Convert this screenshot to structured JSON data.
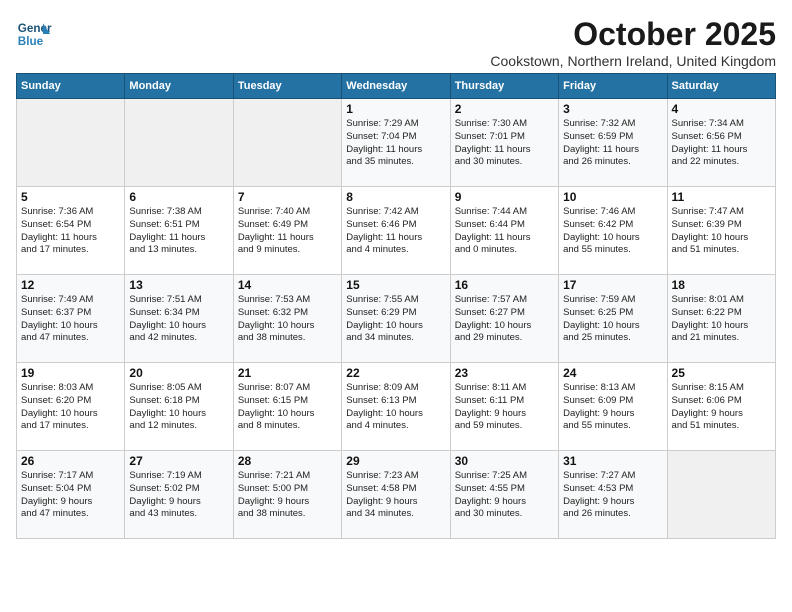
{
  "logo": {
    "line1": "General",
    "line2": "Blue"
  },
  "title": "October 2025",
  "subtitle": "Cookstown, Northern Ireland, United Kingdom",
  "weekdays": [
    "Sunday",
    "Monday",
    "Tuesday",
    "Wednesday",
    "Thursday",
    "Friday",
    "Saturday"
  ],
  "weeks": [
    [
      {
        "day": "",
        "info": ""
      },
      {
        "day": "",
        "info": ""
      },
      {
        "day": "",
        "info": ""
      },
      {
        "day": "1",
        "info": "Sunrise: 7:29 AM\nSunset: 7:04 PM\nDaylight: 11 hours\nand 35 minutes."
      },
      {
        "day": "2",
        "info": "Sunrise: 7:30 AM\nSunset: 7:01 PM\nDaylight: 11 hours\nand 30 minutes."
      },
      {
        "day": "3",
        "info": "Sunrise: 7:32 AM\nSunset: 6:59 PM\nDaylight: 11 hours\nand 26 minutes."
      },
      {
        "day": "4",
        "info": "Sunrise: 7:34 AM\nSunset: 6:56 PM\nDaylight: 11 hours\nand 22 minutes."
      }
    ],
    [
      {
        "day": "5",
        "info": "Sunrise: 7:36 AM\nSunset: 6:54 PM\nDaylight: 11 hours\nand 17 minutes."
      },
      {
        "day": "6",
        "info": "Sunrise: 7:38 AM\nSunset: 6:51 PM\nDaylight: 11 hours\nand 13 minutes."
      },
      {
        "day": "7",
        "info": "Sunrise: 7:40 AM\nSunset: 6:49 PM\nDaylight: 11 hours\nand 9 minutes."
      },
      {
        "day": "8",
        "info": "Sunrise: 7:42 AM\nSunset: 6:46 PM\nDaylight: 11 hours\nand 4 minutes."
      },
      {
        "day": "9",
        "info": "Sunrise: 7:44 AM\nSunset: 6:44 PM\nDaylight: 11 hours\nand 0 minutes."
      },
      {
        "day": "10",
        "info": "Sunrise: 7:46 AM\nSunset: 6:42 PM\nDaylight: 10 hours\nand 55 minutes."
      },
      {
        "day": "11",
        "info": "Sunrise: 7:47 AM\nSunset: 6:39 PM\nDaylight: 10 hours\nand 51 minutes."
      }
    ],
    [
      {
        "day": "12",
        "info": "Sunrise: 7:49 AM\nSunset: 6:37 PM\nDaylight: 10 hours\nand 47 minutes."
      },
      {
        "day": "13",
        "info": "Sunrise: 7:51 AM\nSunset: 6:34 PM\nDaylight: 10 hours\nand 42 minutes."
      },
      {
        "day": "14",
        "info": "Sunrise: 7:53 AM\nSunset: 6:32 PM\nDaylight: 10 hours\nand 38 minutes."
      },
      {
        "day": "15",
        "info": "Sunrise: 7:55 AM\nSunset: 6:29 PM\nDaylight: 10 hours\nand 34 minutes."
      },
      {
        "day": "16",
        "info": "Sunrise: 7:57 AM\nSunset: 6:27 PM\nDaylight: 10 hours\nand 29 minutes."
      },
      {
        "day": "17",
        "info": "Sunrise: 7:59 AM\nSunset: 6:25 PM\nDaylight: 10 hours\nand 25 minutes."
      },
      {
        "day": "18",
        "info": "Sunrise: 8:01 AM\nSunset: 6:22 PM\nDaylight: 10 hours\nand 21 minutes."
      }
    ],
    [
      {
        "day": "19",
        "info": "Sunrise: 8:03 AM\nSunset: 6:20 PM\nDaylight: 10 hours\nand 17 minutes."
      },
      {
        "day": "20",
        "info": "Sunrise: 8:05 AM\nSunset: 6:18 PM\nDaylight: 10 hours\nand 12 minutes."
      },
      {
        "day": "21",
        "info": "Sunrise: 8:07 AM\nSunset: 6:15 PM\nDaylight: 10 hours\nand 8 minutes."
      },
      {
        "day": "22",
        "info": "Sunrise: 8:09 AM\nSunset: 6:13 PM\nDaylight: 10 hours\nand 4 minutes."
      },
      {
        "day": "23",
        "info": "Sunrise: 8:11 AM\nSunset: 6:11 PM\nDaylight: 9 hours\nand 59 minutes."
      },
      {
        "day": "24",
        "info": "Sunrise: 8:13 AM\nSunset: 6:09 PM\nDaylight: 9 hours\nand 55 minutes."
      },
      {
        "day": "25",
        "info": "Sunrise: 8:15 AM\nSunset: 6:06 PM\nDaylight: 9 hours\nand 51 minutes."
      }
    ],
    [
      {
        "day": "26",
        "info": "Sunrise: 7:17 AM\nSunset: 5:04 PM\nDaylight: 9 hours\nand 47 minutes."
      },
      {
        "day": "27",
        "info": "Sunrise: 7:19 AM\nSunset: 5:02 PM\nDaylight: 9 hours\nand 43 minutes."
      },
      {
        "day": "28",
        "info": "Sunrise: 7:21 AM\nSunset: 5:00 PM\nDaylight: 9 hours\nand 38 minutes."
      },
      {
        "day": "29",
        "info": "Sunrise: 7:23 AM\nSunset: 4:58 PM\nDaylight: 9 hours\nand 34 minutes."
      },
      {
        "day": "30",
        "info": "Sunrise: 7:25 AM\nSunset: 4:55 PM\nDaylight: 9 hours\nand 30 minutes."
      },
      {
        "day": "31",
        "info": "Sunrise: 7:27 AM\nSunset: 4:53 PM\nDaylight: 9 hours\nand 26 minutes."
      },
      {
        "day": "",
        "info": ""
      }
    ]
  ]
}
